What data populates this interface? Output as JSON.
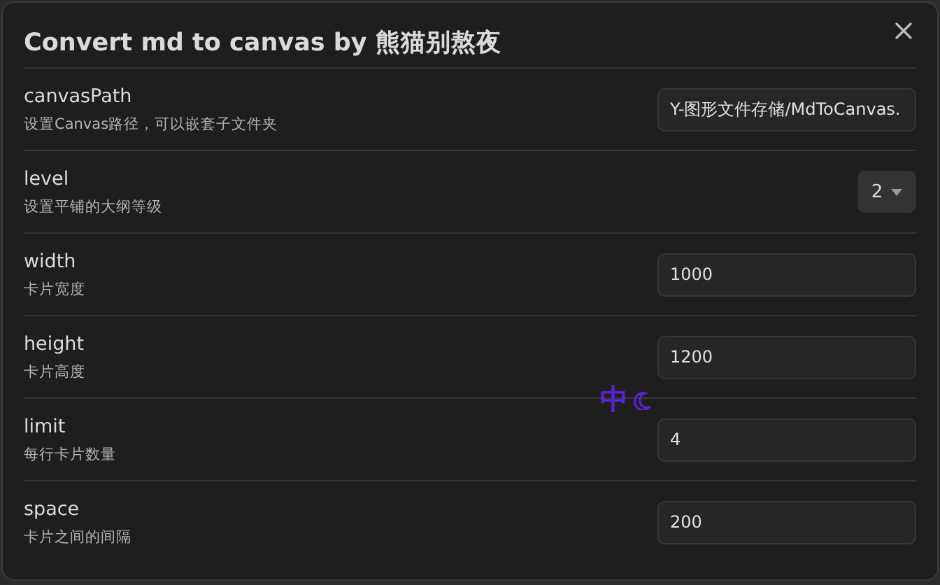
{
  "dialog": {
    "title": "Convert md to canvas by 熊猫别熬夜"
  },
  "settings": [
    {
      "kind": "text",
      "name": "canvasPath",
      "description": "设置Canvas路径，可以嵌套子文件夹",
      "value": "Y-图形文件存储/MdToCanvas."
    },
    {
      "kind": "dropdown",
      "name": "level",
      "description": "设置平铺的大纲等级",
      "value": "2"
    },
    {
      "kind": "text",
      "name": "width",
      "description": "卡片宽度",
      "value": "1000"
    },
    {
      "kind": "text",
      "name": "height",
      "description": "卡片高度",
      "value": "1200"
    },
    {
      "kind": "text",
      "name": "limit",
      "description": "每行卡片数量",
      "value": "4"
    },
    {
      "kind": "text",
      "name": "space",
      "description": "卡片之间的间隔",
      "value": "200"
    }
  ],
  "ime_indicator": {
    "mode": "中"
  }
}
